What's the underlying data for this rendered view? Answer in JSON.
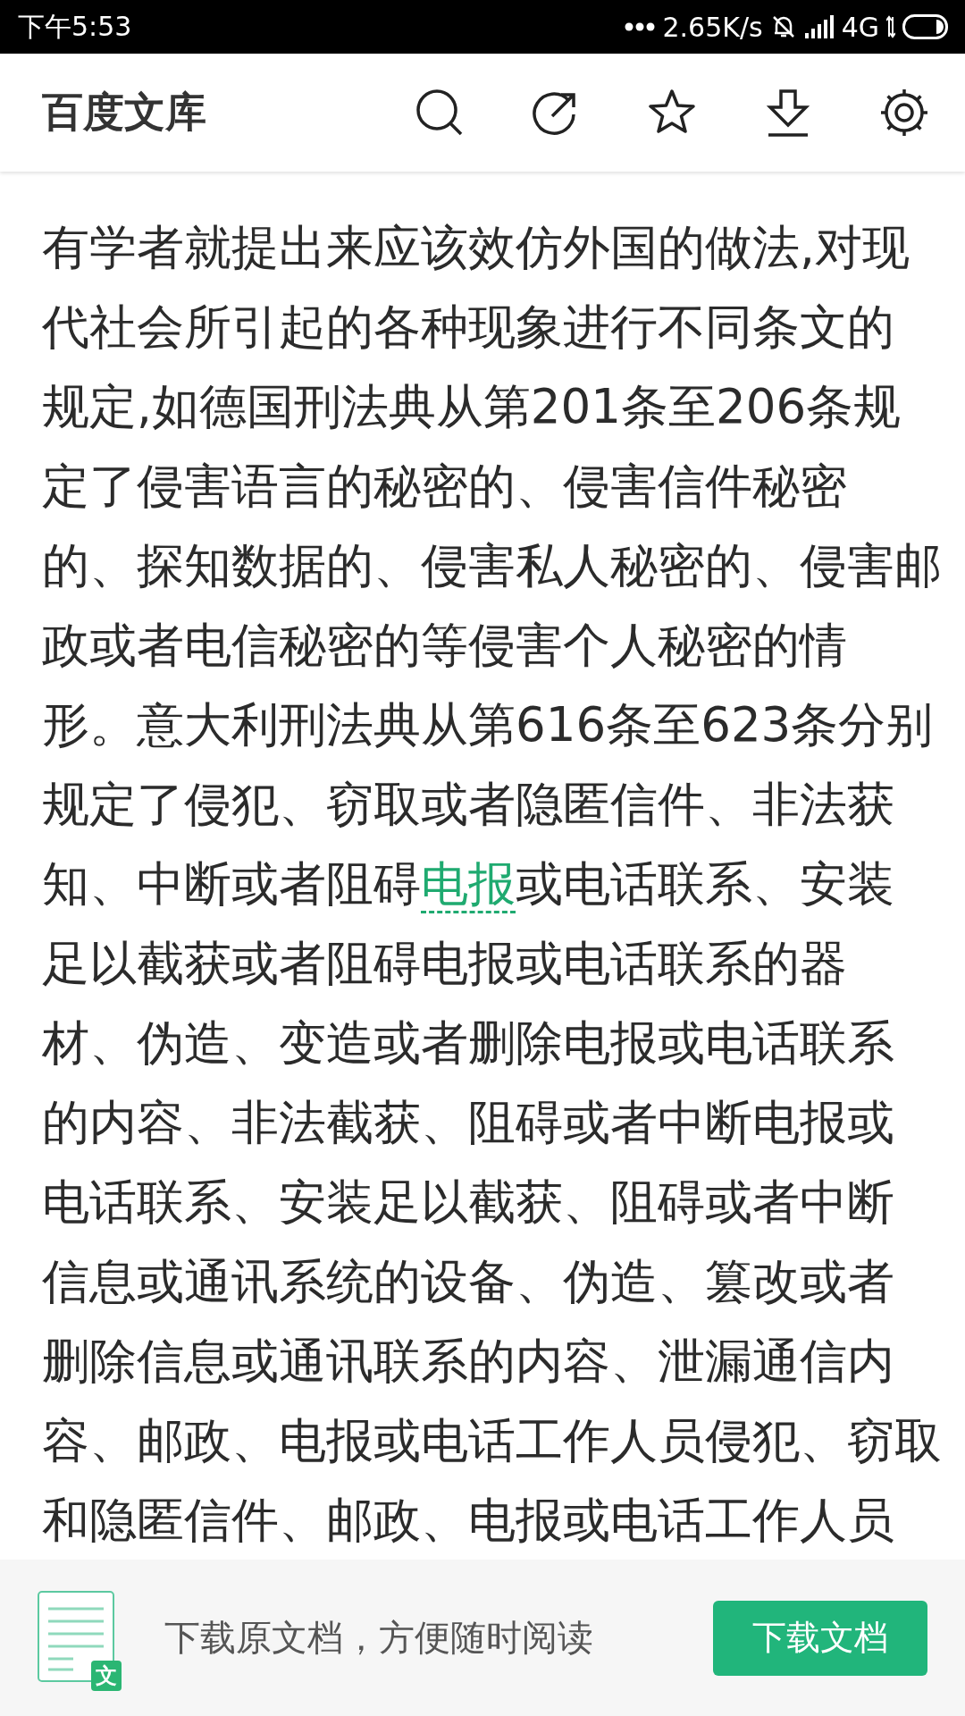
{
  "status_bar": {
    "time": "下午5:53",
    "speed": "2.65K/s",
    "network": "4G"
  },
  "header": {
    "title": "百度文库"
  },
  "article": {
    "lines": [
      [
        {
          "kind": "plain",
          "text": "有学者就提出来应该效仿外国的做法,对现"
        }
      ],
      [
        {
          "kind": "plain",
          "text": "代社会所引起的各种现象进行不同条文的"
        }
      ],
      [
        {
          "kind": "plain",
          "text": "规定,如德国刑法典从第201条至206条规"
        }
      ],
      [
        {
          "kind": "plain",
          "text": "定了侵害语言的秘密的、侵害信件秘密"
        }
      ],
      [
        {
          "kind": "plain",
          "text": "的、探知数据的、侵害私人秘密的、侵害邮"
        }
      ],
      [
        {
          "kind": "plain",
          "text": "政或者电信秘密的等侵害个人秘密的情"
        }
      ],
      [
        {
          "kind": "plain",
          "text": "形。意大利刑法典从第616条至623条分别"
        }
      ],
      [
        {
          "kind": "plain",
          "text": "规定了侵犯、窃取或者隐匿信件、非法获"
        }
      ],
      [
        {
          "kind": "plain",
          "text": "知、中断或者阻碍"
        },
        {
          "kind": "link",
          "text": "电报"
        },
        {
          "kind": "plain",
          "text": "或电话联系、安装"
        }
      ],
      [
        {
          "kind": "plain",
          "text": "足以截获或者阻碍电报或电话联系的器"
        }
      ],
      [
        {
          "kind": "plain",
          "text": "材、伪造、变造或者删除电报或电话联系"
        }
      ],
      [
        {
          "kind": "plain",
          "text": "的内容、非法截获、阻碍或者中断电报或"
        }
      ],
      [
        {
          "kind": "plain",
          "text": "电话联系、安装足以截获、阻碍或者中断"
        }
      ],
      [
        {
          "kind": "plain",
          "text": "信息或通讯系统的设备、伪造、篡改或者"
        }
      ],
      [
        {
          "kind": "plain",
          "text": "删除信息或通讯联系的内容、泄漏通信内"
        }
      ],
      [
        {
          "kind": "plain",
          "text": "容、邮政、电报或电话工作人员侵犯、窃取"
        }
      ],
      [
        {
          "kind": "plain",
          "text": "和隐匿信件、邮政、电报或电话工作人员"
        }
      ]
    ]
  },
  "banner": {
    "icon_label": "文",
    "message": "下载原文档，方便随时阅读",
    "button": "下载文档"
  }
}
